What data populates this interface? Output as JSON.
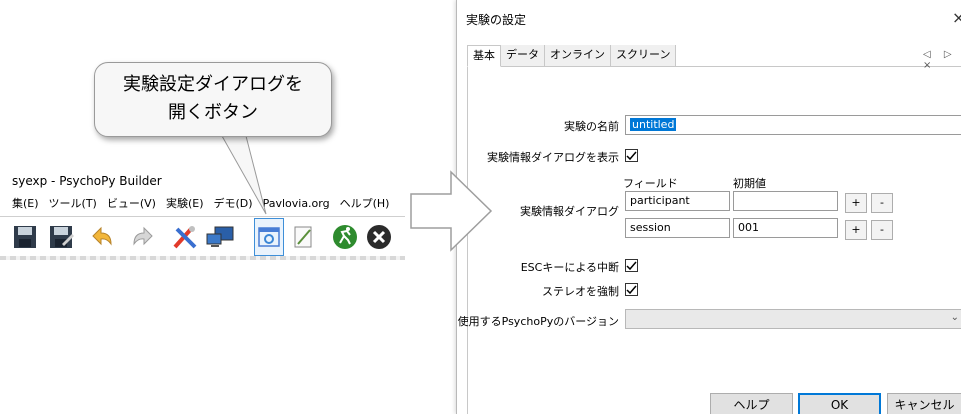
{
  "callout": {
    "line1": "実験設定ダイアログを",
    "line2": "開くボタン"
  },
  "builder": {
    "title": "syexp - PsychoPy Builder",
    "menu": [
      "集(E)",
      "ツール(T)",
      "ビュー(V)",
      "実験(E)",
      "デモ(D)",
      "Pavlovia.org",
      "ヘルプ(H)"
    ],
    "toolbar_icons": [
      "save-icon",
      "save-as-icon",
      "undo-icon",
      "redo-icon",
      "preferences-icon",
      "monitor-icon",
      "experiment-settings-icon",
      "compile-script-icon",
      "run-icon",
      "stop-icon"
    ]
  },
  "dialog": {
    "title": "実験の設定",
    "close": "×",
    "tabs": [
      "基本",
      "データ",
      "オンライン",
      "スクリーン"
    ],
    "tab_nav": "◁ ▷ ×",
    "experiment_name_label": "実験の名前",
    "experiment_name_value": "untitled",
    "show_info_label": "実験情報ダイアログを表示",
    "info_dialog_label": "実験情報ダイアログ",
    "field_header": "フィールド",
    "default_header": "初期値",
    "info_rows": [
      {
        "field": "participant",
        "value": ""
      },
      {
        "field": "session",
        "value": "001"
      }
    ],
    "add_label": "+",
    "remove_label": "-",
    "esc_label": "ESCキーによる中断",
    "stereo_label": "ステレオを強制",
    "version_label": "使用するPsychoPyのバージョン",
    "version_value": "",
    "help_button": "ヘルプ",
    "ok_button": "OK",
    "cancel_button": "キャンセル"
  },
  "colors": {
    "accent": "#0078d7",
    "highlight": "#3e8fd8"
  }
}
